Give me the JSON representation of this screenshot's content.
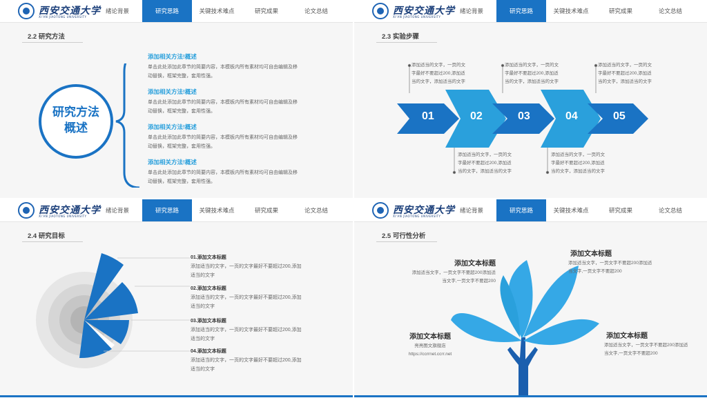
{
  "header": {
    "brand": "西安交通大学",
    "brand_sub": "XI'AN JIAOTONG UNIVERSITY",
    "nav": [
      "绪论背景",
      "研究思路",
      "关键技术难点",
      "研究成果",
      "论文总结"
    ],
    "active_index": 1
  },
  "slide1": {
    "section": "2.2 研究方法",
    "circle": [
      "研究方法",
      "概述"
    ],
    "items": [
      {
        "title": "添加相关方法!概述",
        "body": [
          "单击此处添加此章节的简要内容，本模板内所有素材均可自由编辑及移",
          "动替换，框架完整，套用性强。"
        ]
      },
      {
        "title": "添加相关方法!概述",
        "body": [
          "单击此处添加此章节的简要内容，本模板内所有素材均可自由编辑及移",
          "动替换，框架完整，套用性强。"
        ]
      },
      {
        "title": "添加相关方法!概述",
        "body": [
          "单击此处添加此章节的简要内容，本模板内所有素材均可自由编辑及移",
          "动替换，框架完整，套用性强。"
        ]
      },
      {
        "title": "添加相关方法!概述",
        "body": [
          "单击此处添加此章节的简要内容，本模板内所有素材均可自由编辑及移",
          "动替换，框架完整，套用性强。"
        ]
      }
    ]
  },
  "slide2": {
    "section": "2.3 实验步骤",
    "steps": [
      "01",
      "02",
      "03",
      "04",
      "05"
    ],
    "top_notes": [
      [
        "添加适当的文字，一页的文",
        "字最好不要超过200,添加适",
        "当的文字，添加适当的文字"
      ],
      [
        "添加适当的文字，一页的文",
        "字最好不要超过200,添加适",
        "当的文字，添加适当的文字"
      ],
      [
        "添加适当的文字，一页的文",
        "字最好不要超过200,添加适",
        "当的文字，添加适当的文字"
      ]
    ],
    "bottom_notes": [
      [
        "添加适当的文字，一页的文",
        "字最好不要超过200,添加适",
        "当的文字，添加适当的文字"
      ],
      [
        "添加适当的文字，一页的文",
        "字最好不要超过200,添加适",
        "当的文字，添加适当的文字"
      ]
    ]
  },
  "slide3": {
    "section": "2.4 研究目标",
    "items": [
      {
        "title": "01.添加文本标题",
        "body": [
          "添加适当的文字，一页的文字最好不要超过200,添加",
          "适当的文字"
        ]
      },
      {
        "title": "02.添加文本标题",
        "body": [
          "添加适当的文字，一页的文字最好不要超过200,添加",
          "适当的文字"
        ]
      },
      {
        "title": "03.添加文本标题",
        "body": [
          "添加适当的文字，一页的文字最好不要超过200,添加",
          "适当的文字"
        ]
      },
      {
        "title": "04.添加文本标题",
        "body": [
          "添加适当的文字，一页的文字最好不要超过200,添加",
          "适当的文字"
        ]
      }
    ]
  },
  "slide4": {
    "section": "2.5 可行性分析",
    "blocks": [
      {
        "title": "添加文本标题",
        "body": [
          "添加适当文字，一页文字不要超200添加适",
          "当文字,一页文字不要超200"
        ]
      },
      {
        "title": "添加文本标题",
        "body": [
          "添加适当文字，一页文字不要超200添加适",
          "当文字,一页文字不要超200"
        ]
      },
      {
        "title": "添加文本标题",
        "body": [
          "亮亮图文旗舰店",
          "https://ccrrnet.ccrr.net"
        ]
      },
      {
        "title": "添加文本标题",
        "body": [
          "添加适当文字，一页文字不要超200添加适",
          "当文字,一页文字不要超200"
        ]
      }
    ]
  },
  "colors": {
    "primary": "#1a73c4",
    "light": "#2aa0dc",
    "leaf": "#35a8e6",
    "dark": "#1b5fae"
  }
}
